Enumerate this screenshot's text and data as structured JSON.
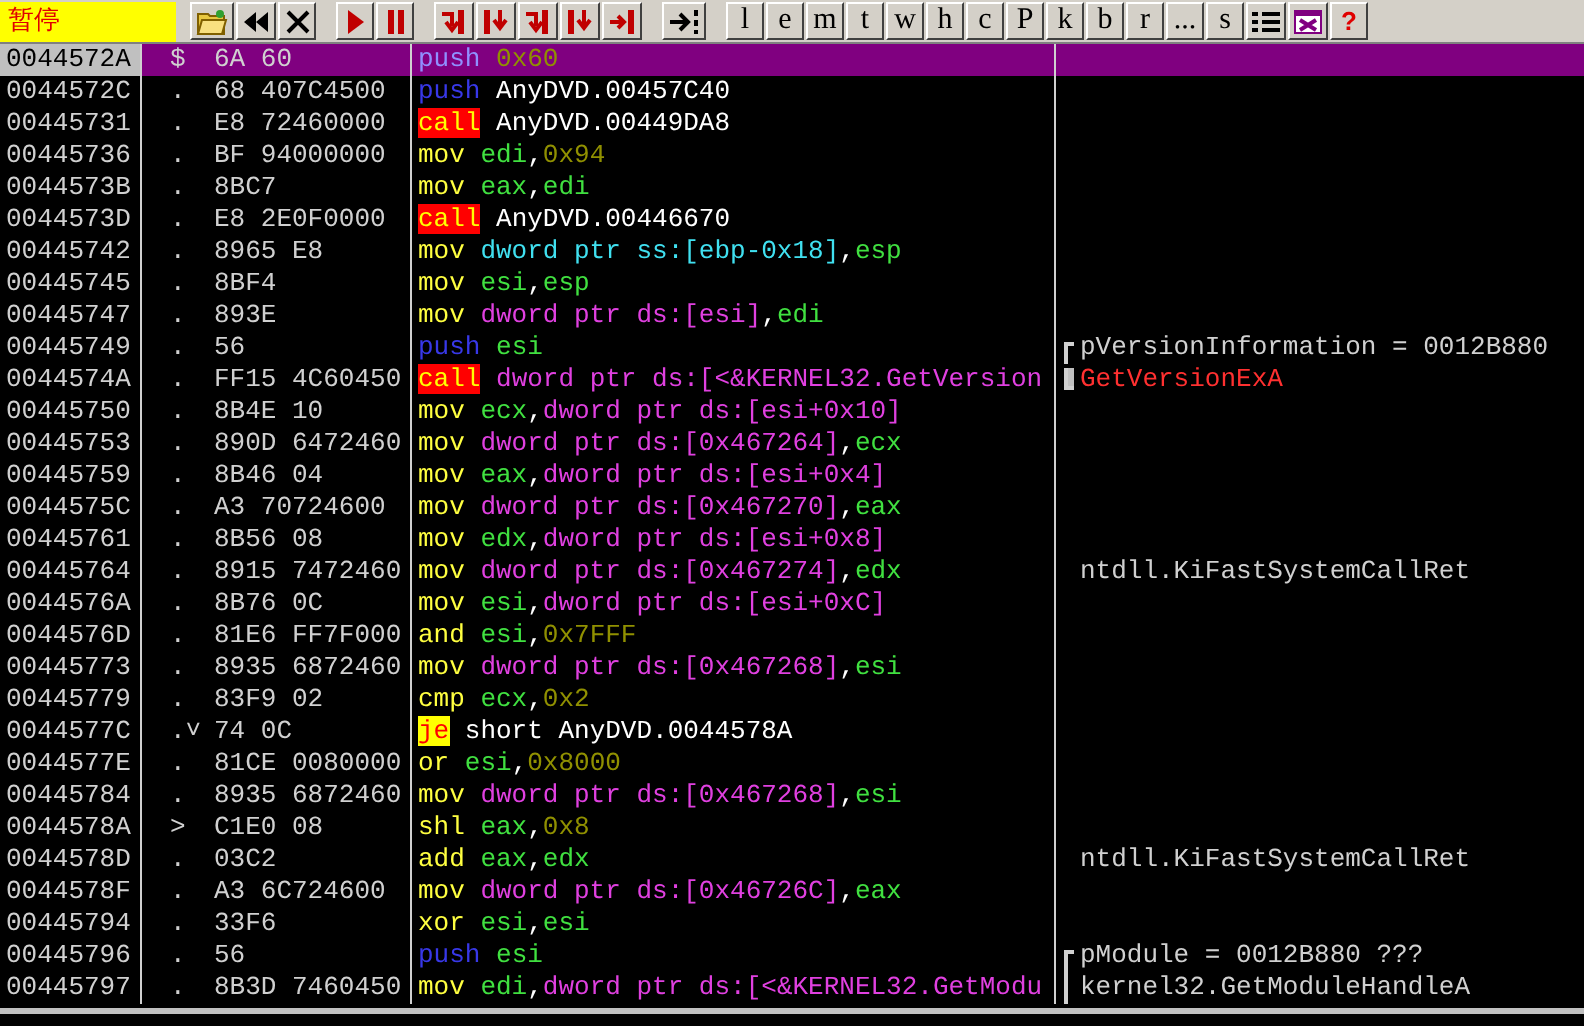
{
  "toolbar": {
    "status": "暂停",
    "letter_buttons": [
      "l",
      "e",
      "m",
      "t",
      "w",
      "h",
      "c",
      "P",
      "k",
      "b",
      "r",
      "...",
      "s"
    ],
    "help": "?"
  },
  "rows": [
    {
      "address": "0044572A",
      "marker": "$",
      "hex": "6A 60",
      "mnemonic": "push",
      "kind": "push",
      "operands": [
        {
          "text": "0x60",
          "kind": "const"
        }
      ],
      "selected": true
    },
    {
      "address": "0044572C",
      "marker": ".",
      "hex": "68 407C4500",
      "mnemonic": "push",
      "kind": "push",
      "operands": [
        {
          "text": "AnyDVD.00457C40",
          "kind": "sym"
        }
      ],
      "selected": false
    },
    {
      "address": "00445731",
      "marker": ".",
      "hex": "E8 72460000",
      "mnemonic": "call",
      "kind": "call",
      "operands": [
        {
          "text": "AnyDVD.00449DA8",
          "kind": "sym"
        }
      ],
      "selected": false
    },
    {
      "address": "00445736",
      "marker": ".",
      "hex": "BF 94000000",
      "mnemonic": "mov",
      "kind": "op",
      "operands": [
        {
          "text": "edi",
          "kind": "reg"
        },
        {
          "text": ",",
          "kind": "sep"
        },
        {
          "text": "0x94",
          "kind": "const"
        }
      ],
      "selected": false
    },
    {
      "address": "0044573B",
      "marker": ".",
      "hex": "8BC7",
      "mnemonic": "mov",
      "kind": "op",
      "operands": [
        {
          "text": "eax",
          "kind": "reg"
        },
        {
          "text": ",",
          "kind": "sep"
        },
        {
          "text": "edi",
          "kind": "reg"
        }
      ],
      "selected": false
    },
    {
      "address": "0044573D",
      "marker": ".",
      "hex": "E8 2E0F0000",
      "mnemonic": "call",
      "kind": "call",
      "operands": [
        {
          "text": "AnyDVD.00446670",
          "kind": "sym"
        }
      ],
      "selected": false
    },
    {
      "address": "00445742",
      "marker": ".",
      "hex": "8965 E8",
      "mnemonic": "mov",
      "kind": "op",
      "operands": [
        {
          "text": "dword ptr ss:[ebp-0x18]",
          "kind": "stack"
        },
        {
          "text": ",",
          "kind": "sep"
        },
        {
          "text": "esp",
          "kind": "reg"
        }
      ],
      "selected": false
    },
    {
      "address": "00445745",
      "marker": ".",
      "hex": "8BF4",
      "mnemonic": "mov",
      "kind": "op",
      "operands": [
        {
          "text": "esi",
          "kind": "reg"
        },
        {
          "text": ",",
          "kind": "sep"
        },
        {
          "text": "esp",
          "kind": "reg"
        }
      ],
      "selected": false
    },
    {
      "address": "00445747",
      "marker": ".",
      "hex": "893E",
      "mnemonic": "mov",
      "kind": "op",
      "operands": [
        {
          "text": "dword ptr ds:[esi]",
          "kind": "mem"
        },
        {
          "text": ",",
          "kind": "sep"
        },
        {
          "text": "edi",
          "kind": "reg"
        }
      ],
      "selected": false
    },
    {
      "address": "00445749",
      "marker": ".",
      "hex": "56",
      "mnemonic": "push",
      "kind": "push",
      "operands": [
        {
          "text": "esi",
          "kind": "reg"
        }
      ],
      "selected": false,
      "comment": {
        "text": "pVersionInformation = 0012B880",
        "kind": "note",
        "bracketed": true,
        "bracket_top": true,
        "bracket_bottom": false
      }
    },
    {
      "address": "0044574A",
      "marker": ".",
      "hex": "FF15 4C60450",
      "mnemonic": "call",
      "kind": "call",
      "operands": [
        {
          "text": "dword ptr ds:[<&KERNEL32.GetVersion",
          "kind": "mem"
        }
      ],
      "selected": false,
      "comment": {
        "text": "GetVersionExA",
        "kind": "api",
        "bracketed": true,
        "bracket_top": false,
        "bracket_bottom": true
      }
    },
    {
      "address": "00445750",
      "marker": ".",
      "hex": "8B4E 10",
      "mnemonic": "mov",
      "kind": "op",
      "operands": [
        {
          "text": "ecx",
          "kind": "reg"
        },
        {
          "text": ",",
          "kind": "sep"
        },
        {
          "text": "dword ptr ds:[esi+0x10]",
          "kind": "mem"
        }
      ],
      "selected": false
    },
    {
      "address": "00445753",
      "marker": ".",
      "hex": "890D 6472460",
      "mnemonic": "mov",
      "kind": "op",
      "operands": [
        {
          "text": "dword ptr ds:[0x467264]",
          "kind": "mem"
        },
        {
          "text": ",",
          "kind": "sep"
        },
        {
          "text": "ecx",
          "kind": "reg"
        }
      ],
      "selected": false
    },
    {
      "address": "00445759",
      "marker": ".",
      "hex": "8B46 04",
      "mnemonic": "mov",
      "kind": "op",
      "operands": [
        {
          "text": "eax",
          "kind": "reg"
        },
        {
          "text": ",",
          "kind": "sep"
        },
        {
          "text": "dword ptr ds:[esi+0x4]",
          "kind": "mem"
        }
      ],
      "selected": false
    },
    {
      "address": "0044575C",
      "marker": ".",
      "hex": "A3 70724600",
      "mnemonic": "mov",
      "kind": "op",
      "operands": [
        {
          "text": "dword ptr ds:[0x467270]",
          "kind": "mem"
        },
        {
          "text": ",",
          "kind": "sep"
        },
        {
          "text": "eax",
          "kind": "reg"
        }
      ],
      "selected": false
    },
    {
      "address": "00445761",
      "marker": ".",
      "hex": "8B56 08",
      "mnemonic": "mov",
      "kind": "op",
      "operands": [
        {
          "text": "edx",
          "kind": "reg"
        },
        {
          "text": ",",
          "kind": "sep"
        },
        {
          "text": "dword ptr ds:[esi+0x8]",
          "kind": "mem"
        }
      ],
      "selected": false
    },
    {
      "address": "00445764",
      "marker": ".",
      "hex": "8915 7472460",
      "mnemonic": "mov",
      "kind": "op",
      "operands": [
        {
          "text": "dword ptr ds:[0x467274]",
          "kind": "mem"
        },
        {
          "text": ",",
          "kind": "sep"
        },
        {
          "text": "edx",
          "kind": "reg"
        }
      ],
      "selected": false,
      "comment": {
        "text": "ntdll.KiFastSystemCallRet",
        "kind": "note",
        "bracketed": false
      }
    },
    {
      "address": "0044576A",
      "marker": ".",
      "hex": "8B76 0C",
      "mnemonic": "mov",
      "kind": "op",
      "operands": [
        {
          "text": "esi",
          "kind": "reg"
        },
        {
          "text": ",",
          "kind": "sep"
        },
        {
          "text": "dword ptr ds:[esi+0xC]",
          "kind": "mem"
        }
      ],
      "selected": false
    },
    {
      "address": "0044576D",
      "marker": ".",
      "hex": "81E6 FF7F000",
      "mnemonic": "and",
      "kind": "op",
      "operands": [
        {
          "text": "esi",
          "kind": "reg"
        },
        {
          "text": ",",
          "kind": "sep"
        },
        {
          "text": "0x7FFF",
          "kind": "const"
        }
      ],
      "selected": false
    },
    {
      "address": "00445773",
      "marker": ".",
      "hex": "8935 6872460",
      "mnemonic": "mov",
      "kind": "op",
      "operands": [
        {
          "text": "dword ptr ds:[0x467268]",
          "kind": "mem"
        },
        {
          "text": ",",
          "kind": "sep"
        },
        {
          "text": "esi",
          "kind": "reg"
        }
      ],
      "selected": false
    },
    {
      "address": "00445779",
      "marker": ".",
      "hex": "83F9 02",
      "mnemonic": "cmp",
      "kind": "op",
      "operands": [
        {
          "text": "ecx",
          "kind": "reg"
        },
        {
          "text": ",",
          "kind": "sep"
        },
        {
          "text": "0x2",
          "kind": "const"
        }
      ],
      "selected": false
    },
    {
      "address": "0044577C",
      "marker": ".˅",
      "hex": "74 0C",
      "mnemonic": "je",
      "kind": "jump",
      "operands": [
        {
          "text": "short AnyDVD.0044578A",
          "kind": "sym"
        }
      ],
      "selected": false
    },
    {
      "address": "0044577E",
      "marker": ".",
      "hex": "81CE 0080000",
      "mnemonic": "or",
      "kind": "op",
      "operands": [
        {
          "text": "esi",
          "kind": "reg"
        },
        {
          "text": ",",
          "kind": "sep"
        },
        {
          "text": "0x8000",
          "kind": "const"
        }
      ],
      "selected": false
    },
    {
      "address": "00445784",
      "marker": ".",
      "hex": "8935 6872460",
      "mnemonic": "mov",
      "kind": "op",
      "operands": [
        {
          "text": "dword ptr ds:[0x467268]",
          "kind": "mem"
        },
        {
          "text": ",",
          "kind": "sep"
        },
        {
          "text": "esi",
          "kind": "reg"
        }
      ],
      "selected": false
    },
    {
      "address": "0044578A",
      "marker": ">",
      "hex": "C1E0 08",
      "mnemonic": "shl",
      "kind": "op",
      "operands": [
        {
          "text": "eax",
          "kind": "reg"
        },
        {
          "text": ",",
          "kind": "sep"
        },
        {
          "text": "0x8",
          "kind": "const"
        }
      ],
      "selected": false
    },
    {
      "address": "0044578D",
      "marker": ".",
      "hex": "03C2",
      "mnemonic": "add",
      "kind": "op",
      "operands": [
        {
          "text": "eax",
          "kind": "reg"
        },
        {
          "text": ",",
          "kind": "sep"
        },
        {
          "text": "edx",
          "kind": "reg"
        }
      ],
      "selected": false,
      "comment": {
        "text": "ntdll.KiFastSystemCallRet",
        "kind": "note",
        "bracketed": false
      }
    },
    {
      "address": "0044578F",
      "marker": ".",
      "hex": "A3 6C724600",
      "mnemonic": "mov",
      "kind": "op",
      "operands": [
        {
          "text": "dword ptr ds:[0x46726C]",
          "kind": "mem"
        },
        {
          "text": ",",
          "kind": "sep"
        },
        {
          "text": "eax",
          "kind": "reg"
        }
      ],
      "selected": false
    },
    {
      "address": "00445794",
      "marker": ".",
      "hex": "33F6",
      "mnemonic": "xor",
      "kind": "op",
      "operands": [
        {
          "text": "esi",
          "kind": "reg"
        },
        {
          "text": ",",
          "kind": "sep"
        },
        {
          "text": "esi",
          "kind": "reg"
        }
      ],
      "selected": false
    },
    {
      "address": "00445796",
      "marker": ".",
      "hex": "56",
      "mnemonic": "push",
      "kind": "push",
      "operands": [
        {
          "text": "esi",
          "kind": "reg"
        }
      ],
      "selected": false,
      "comment": {
        "text": "pModule = 0012B880 ???",
        "kind": "note",
        "bracketed": true,
        "bracket_top": true,
        "bracket_bottom": false
      }
    },
    {
      "address": "00445797",
      "marker": ".",
      "hex": "8B3D 7460450",
      "mnemonic": "mov",
      "kind": "op",
      "operands": [
        {
          "text": "edi",
          "kind": "reg"
        },
        {
          "text": ",",
          "kind": "sep"
        },
        {
          "text": "dword ptr ds:[<&KERNEL32.GetModu",
          "kind": "mem"
        }
      ],
      "selected": false,
      "comment": {
        "text": "kernel32.GetModuleHandleA",
        "kind": "note",
        "bracketed": true,
        "bracket_top": false,
        "bracket_bottom": false
      }
    }
  ]
}
